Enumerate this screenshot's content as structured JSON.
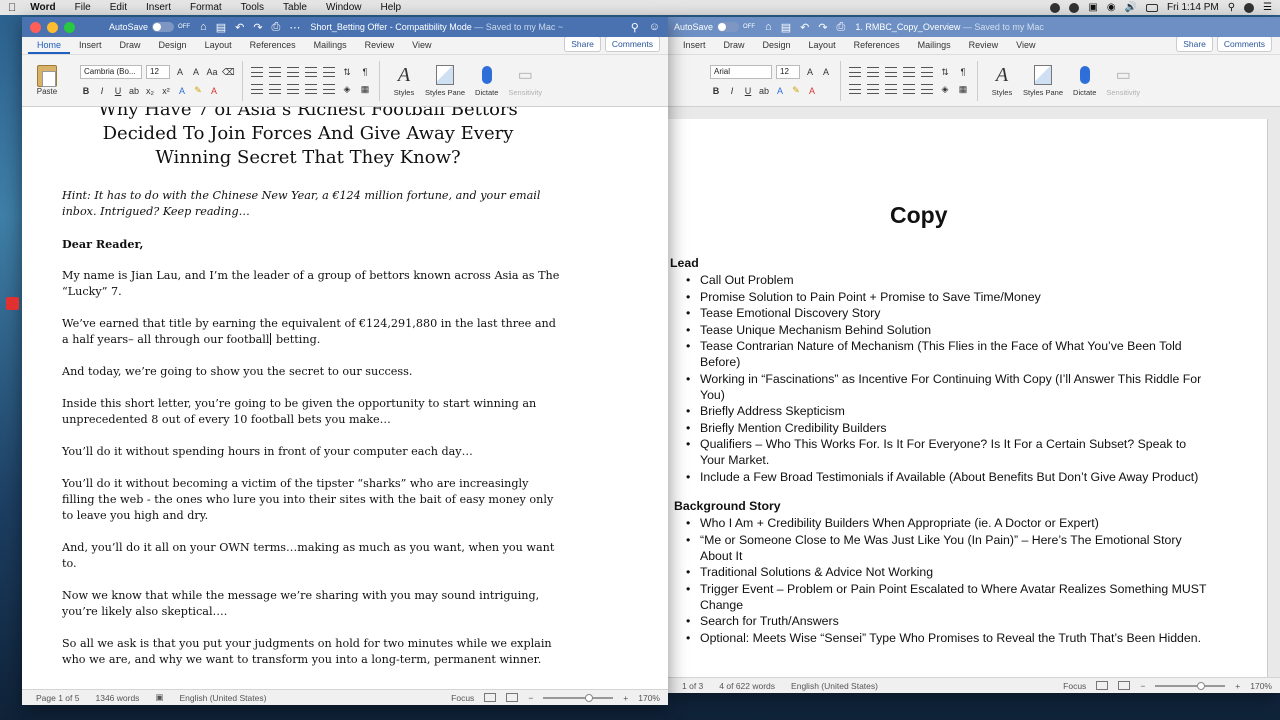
{
  "menubar": {
    "app_name": "Word",
    "items": [
      "File",
      "Edit",
      "Insert",
      "Format",
      "Tools",
      "Table",
      "Window",
      "Help"
    ],
    "clock": "Fri 1:14 PM"
  },
  "left_window": {
    "autosave_label": "AutoSave",
    "autosave_state": "OFF",
    "title": "Short_Betting Offer",
    "title_suffix": "- Compatibility Mode",
    "title_status": "— Saved to my Mac ~",
    "tabs": [
      "Home",
      "Insert",
      "Draw",
      "Design",
      "Layout",
      "References",
      "Mailings",
      "Review",
      "View"
    ],
    "share_label": "Share",
    "comments_label": "Comments",
    "ribbon": {
      "paste_label": "Paste",
      "font_name": "Cambria (Bo...",
      "font_size": "12",
      "styles_label": "Styles",
      "styles_pane_label": "Styles Pane",
      "dictate_label": "Dictate",
      "sensitivity_label": "Sensitivity"
    },
    "document": {
      "headline": "Why Have 7 of Asia’s Richest Football Bettors Decided To Join Forces And Give Away Every Winning Secret That They Know?",
      "hint": "Hint: It has to do with the Chinese New Year, a €124 million fortune, and your email inbox. Intrigued? Keep reading…",
      "greeting": "Dear Reader,",
      "p1": "My name is Jian Lau, and I’m the leader of a group of bettors known across Asia as The “Lucky” 7.",
      "p2a": "We’ve earned that title by earning the equivalent of €124,291,880 in the last three and a half years– all through our football",
      "p2b": " betting.",
      "p3": "And today, we’re going to show you the secret to our success.",
      "p4": "Inside this short letter, you’re going to be given the opportunity to start winning an unprecedented 8 out of every 10 football bets you make…",
      "p5": "You’ll do it without spending hours in front of your computer each day…",
      "p6": "You’ll do it without becoming a victim of the tipster “sharks” who are increasingly filling the web - the ones who lure you into their sites with the bait of easy money only to leave you high and dry.",
      "p7": "And, you’ll do it all on your OWN terms…making as much as you want, when you want to.",
      "p8": "Now we know that while the message we’re sharing with you may sound intriguing, you’re likely also skeptical….",
      "p9": "So all we ask is that you put your judgments on hold for two minutes while we explain who we are, and why we want to transform you into a long-term, permanent winner."
    },
    "status": {
      "page": "Page 1 of 5",
      "words": "1346 words",
      "language": "English (United States)",
      "focus": "Focus",
      "zoom": "170%"
    }
  },
  "right_window": {
    "autosave_label": "AutoSave",
    "autosave_state": "OFF",
    "title": "1. RMBC_Copy_Overview",
    "title_status": "— Saved to my Mac",
    "tabs": [
      "Insert",
      "Draw",
      "Design",
      "Layout",
      "References",
      "Mailings",
      "Review",
      "View"
    ],
    "share_label": "Share",
    "comments_label": "Comments",
    "ribbon": {
      "font_name": "Arial",
      "font_size": "12",
      "styles_label": "Styles",
      "styles_pane_label": "Styles Pane",
      "dictate_label": "Dictate",
      "sensitivity_label": "Sensitivity"
    },
    "document": {
      "title": "Copy",
      "lead_heading": "Lead",
      "lead_items": [
        "Call Out Problem",
        "Promise Solution to Pain Point + Promise to Save Time/Money",
        "Tease Emotional Discovery Story",
        "Tease Unique Mechanism Behind Solution",
        "Tease Contrarian Nature of Mechanism (This Flies in the Face of What You’ve Been Told Before)",
        "Working in “Fascinations” as Incentive For Continuing With Copy (I’ll Answer This Riddle For You)",
        "Briefly Address Skepticism",
        "Briefly Mention Credibility Builders",
        "Qualifiers – Who This Works For. Is It For Everyone? Is It For a Certain Subset? Speak to Your Market.",
        "Include a Few Broad Testimonials if Available (About Benefits But Don’t Give Away Product)"
      ],
      "background_heading": "Background Story",
      "background_items": [
        "Who I Am + Credibility Builders When Appropriate (ie. A Doctor or Expert)",
        "“Me or Someone Close to Me Was Just Like You (In Pain)” – Here’s The Emotional Story About It",
        "Traditional Solutions & Advice Not Working",
        "Trigger Event – Problem or Pain Point Escalated to Where Avatar Realizes Something MUST Change",
        "Search for Truth/Answers",
        "Optional: Meets Wise “Sensei” Type Who Promises to Reveal the Truth That’s Been Hidden."
      ]
    },
    "status": {
      "page": "1 of 3",
      "words": "4 of 622 words",
      "language": "English (United States)",
      "focus": "Focus",
      "zoom": "170%"
    }
  },
  "colors": {
    "titlebar_active": "#4a72b0",
    "titlebar_inactive": "#6d8fc4",
    "accent": "#1f5fbf"
  }
}
